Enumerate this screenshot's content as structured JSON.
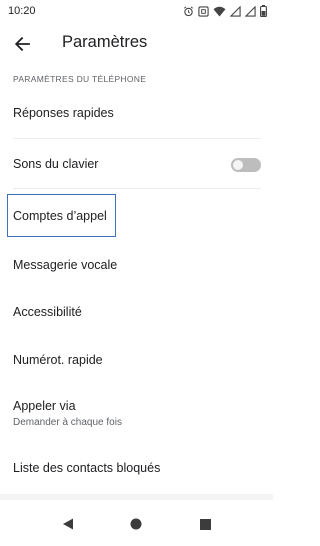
{
  "status_bar": {
    "time": "10:20",
    "icons": [
      "alarm-icon",
      "nfc-icon",
      "wifi-icon",
      "signal-icon",
      "signal-icon",
      "battery-icon"
    ]
  },
  "header": {
    "title": "Paramètres",
    "back_icon": "arrow-back-icon"
  },
  "section": {
    "title": "PARAMÈTRES DU TÉLÉPHONE"
  },
  "settings": {
    "quick_replies": "Réponses rapides",
    "keypad_sounds": "Sons du clavier",
    "keypad_sounds_enabled": false,
    "calling_accounts": "Comptes d’appel",
    "voicemail": "Messagerie vocale",
    "accessibility": "Accessibilité",
    "speed_dial": "Numérot. rapide",
    "call_via": "Appeler via",
    "call_via_value": "Demander à chaque fois",
    "blocked_contacts": "Liste des contacts bloqués"
  },
  "colors": {
    "focus": "#3f6fbf",
    "toggle_off": "#bdbdbd",
    "text_primary": "#202124",
    "text_secondary": "#5f6368"
  },
  "nav_bar": {
    "icons": [
      "back-triangle-icon",
      "home-circle-icon",
      "recents-square-icon"
    ]
  }
}
